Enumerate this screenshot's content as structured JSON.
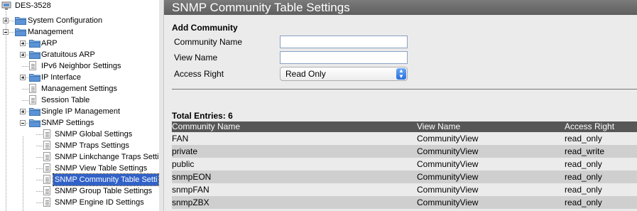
{
  "tree": {
    "root": "DES-3528",
    "items": [
      {
        "label": "System Configuration",
        "depth": 0,
        "kind": "folder",
        "expander": "plus"
      },
      {
        "label": "Management",
        "depth": 0,
        "kind": "folder",
        "expander": "minus"
      },
      {
        "label": "ARP",
        "depth": 1,
        "kind": "folder",
        "expander": "plus"
      },
      {
        "label": "Gratuitous ARP",
        "depth": 1,
        "kind": "folder",
        "expander": "plus"
      },
      {
        "label": "IPv6 Neighbor Settings",
        "depth": 1,
        "kind": "page",
        "expander": ""
      },
      {
        "label": "IP Interface",
        "depth": 1,
        "kind": "folder",
        "expander": "plus"
      },
      {
        "label": "Management Settings",
        "depth": 1,
        "kind": "page",
        "expander": ""
      },
      {
        "label": "Session Table",
        "depth": 1,
        "kind": "page",
        "expander": ""
      },
      {
        "label": "Single IP Management",
        "depth": 1,
        "kind": "folder",
        "expander": "plus"
      },
      {
        "label": "SNMP Settings",
        "depth": 1,
        "kind": "folder",
        "expander": "minus"
      },
      {
        "label": "SNMP Global Settings",
        "depth": 2,
        "kind": "page",
        "expander": ""
      },
      {
        "label": "SNMP Traps Settings",
        "depth": 2,
        "kind": "page",
        "expander": ""
      },
      {
        "label": "SNMP Linkchange Traps Setti",
        "depth": 2,
        "kind": "page",
        "expander": ""
      },
      {
        "label": "SNMP View Table Settings",
        "depth": 2,
        "kind": "page",
        "expander": ""
      },
      {
        "label": "SNMP Community Table Setti",
        "depth": 2,
        "kind": "page",
        "expander": "",
        "selected": true
      },
      {
        "label": "SNMP Group Table Settings",
        "depth": 2,
        "kind": "page",
        "expander": ""
      },
      {
        "label": "SNMP Engine ID Settings",
        "depth": 2,
        "kind": "page",
        "expander": ""
      }
    ]
  },
  "page": {
    "title": "SNMP Community Table Settings",
    "add_section": "Add Community",
    "fields": {
      "community_name_label": "Community Name",
      "community_name_value": "",
      "view_name_label": "View Name",
      "view_name_value": "",
      "access_right_label": "Access Right",
      "access_right_value": "Read Only"
    },
    "total_entries": "Total Entries: 6",
    "table": {
      "headers": [
        "Community Name",
        "View Name",
        "Access Right"
      ],
      "rows": [
        [
          "FAN",
          "CommunityView",
          "read_only"
        ],
        [
          "private",
          "CommunityView",
          "read_write"
        ],
        [
          "public",
          "CommunityView",
          "read_only"
        ],
        [
          "snmpEON",
          "CommunityView",
          "read_only"
        ],
        [
          "snmpFAN",
          "CommunityView",
          "read_only"
        ],
        [
          "snmpZBX",
          "CommunityView",
          "read_only"
        ]
      ]
    }
  },
  "colors": {
    "selection": "#3162c8",
    "title_bar": "#5e5e5e",
    "table_header": "#575757",
    "row_shade": "#cfcfcf",
    "folder": "#6aa0d8"
  },
  "icons": {
    "device": "switch-device-icon",
    "folder": "folder-icon",
    "page": "page-icon",
    "expander": "expand-toggle-icon",
    "select_arrow": "updown-arrow-icon"
  }
}
